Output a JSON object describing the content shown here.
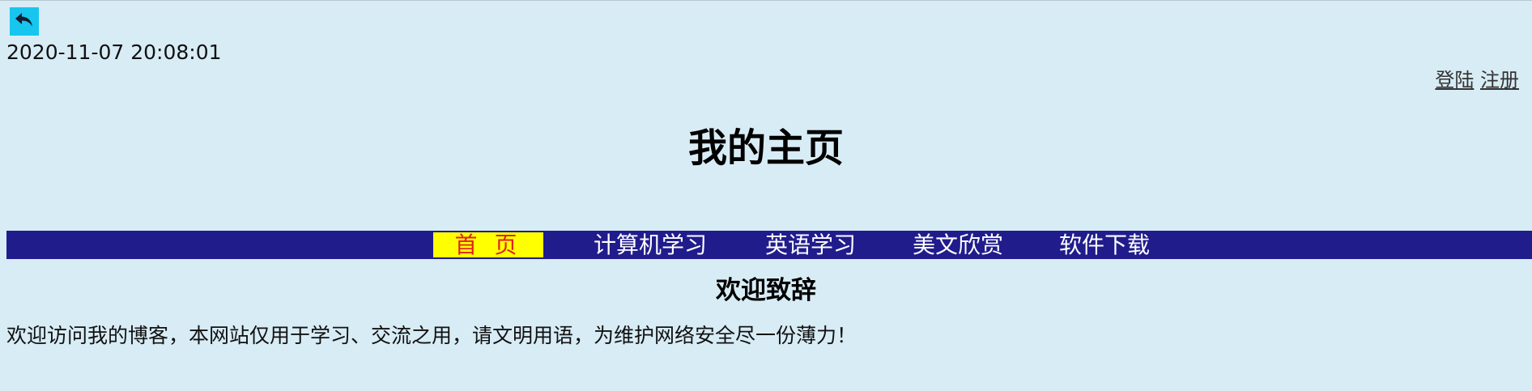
{
  "header": {
    "back_icon": "back-arrow-icon",
    "datetime": "2020-11-07 20:08:01",
    "login_label": "登陆",
    "register_label": "注册"
  },
  "main": {
    "title": "我的主页",
    "nav": [
      {
        "label": "首 页",
        "active": true
      },
      {
        "label": "计算机学习",
        "active": false
      },
      {
        "label": "英语学习",
        "active": false
      },
      {
        "label": "美文欣赏",
        "active": false
      },
      {
        "label": "软件下载",
        "active": false
      }
    ],
    "section_heading": "欢迎致辞",
    "welcome_text": "欢迎访问我的博客，本网站仅用于学习、交流之用，请文明用语，为维护网络安全尽一份薄力！"
  },
  "colors": {
    "background": "#d8ecf5",
    "navbar": "#211c8c",
    "active_nav_bg": "#ffff00",
    "active_nav_text": "#e02020",
    "back_button": "#16c6ee"
  }
}
